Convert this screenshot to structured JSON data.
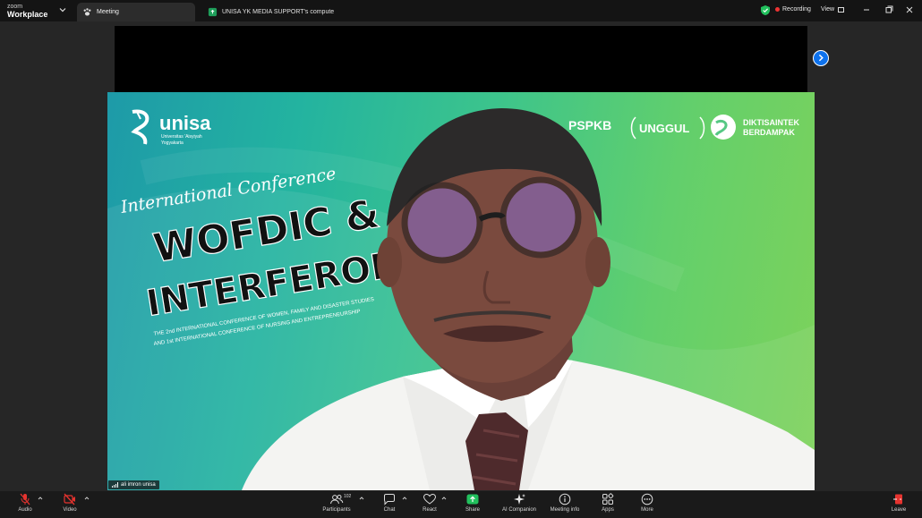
{
  "app": {
    "brand_top": "zoom",
    "brand_bottom": "Workplace"
  },
  "tabs": [
    {
      "label": "Meeting",
      "icon": "paw-icon",
      "active": true
    },
    {
      "label": "UNISA YK MEDIA SUPPORT's compute",
      "icon": "screen-share-icon",
      "active": false
    }
  ],
  "titlebar": {
    "recording_label": "Recording",
    "view_label": "View"
  },
  "video": {
    "participant_name": "ali imron unisa",
    "slide": {
      "logo_name": "unisa",
      "logo_sub1": "Universitas 'Aisyiyah",
      "logo_sub2": "Yogyakarta",
      "script_title": "International Conference",
      "title_line1": "WOFDIC &",
      "title_line2": "INTERFERON",
      "subtitle_line1": "THE 2nd INTERNATIONAL CONFERENCE OF WOMEN, FAMILY AND DISASTER STUDIES",
      "subtitle_line2": "AND 1st INTERNATIONAL CONFERENCE OF NURSING AND ENTREPRENEURSHIP",
      "sponsor1": "PSPKB",
      "sponsor2": "UNGGUL",
      "sponsor3_line1": "DIKTISAINTEK",
      "sponsor3_line2": "BERDAMPAK"
    }
  },
  "toolbar": {
    "audio": "Audio",
    "video": "Video",
    "participants": "Participants",
    "participants_count": "102",
    "chat": "Chat",
    "react": "React",
    "share": "Share",
    "ai_companion": "AI Companion",
    "meeting_info": "Meeting info",
    "apps": "Apps",
    "more": "More",
    "leave": "Leave"
  },
  "colors": {
    "share_green": "#22c05d",
    "leave_red": "#e5332f",
    "accent_blue": "#0e72ed",
    "recording_red": "#ee3333"
  }
}
